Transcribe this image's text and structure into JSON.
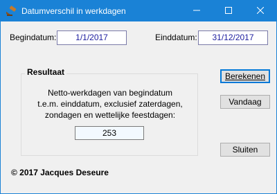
{
  "window": {
    "title": "Datumverschil in werkdagen",
    "controls": {
      "minimize": "minimize-icon",
      "maximize": "maximize-icon",
      "close": "close-icon"
    },
    "accent_color": "#1a82d6"
  },
  "form": {
    "begin_label": "Begindatum:",
    "begin_value": "1/1/2017",
    "end_label": "Einddatum:",
    "end_value": "31/12/2017"
  },
  "result": {
    "group_title": "Resultaat",
    "description_lines": [
      "Netto-werkdagen van begindatum",
      "t.e.m. einddatum, exclusief zaterdagen,",
      "zondagen en wettelijke feestdagen:"
    ],
    "value": "253"
  },
  "buttons": {
    "calculate": "Berekenen",
    "today": "Vandaag",
    "close": "Sluiten"
  },
  "footer": {
    "copyright": "© 2017 Jacques Deseure"
  }
}
